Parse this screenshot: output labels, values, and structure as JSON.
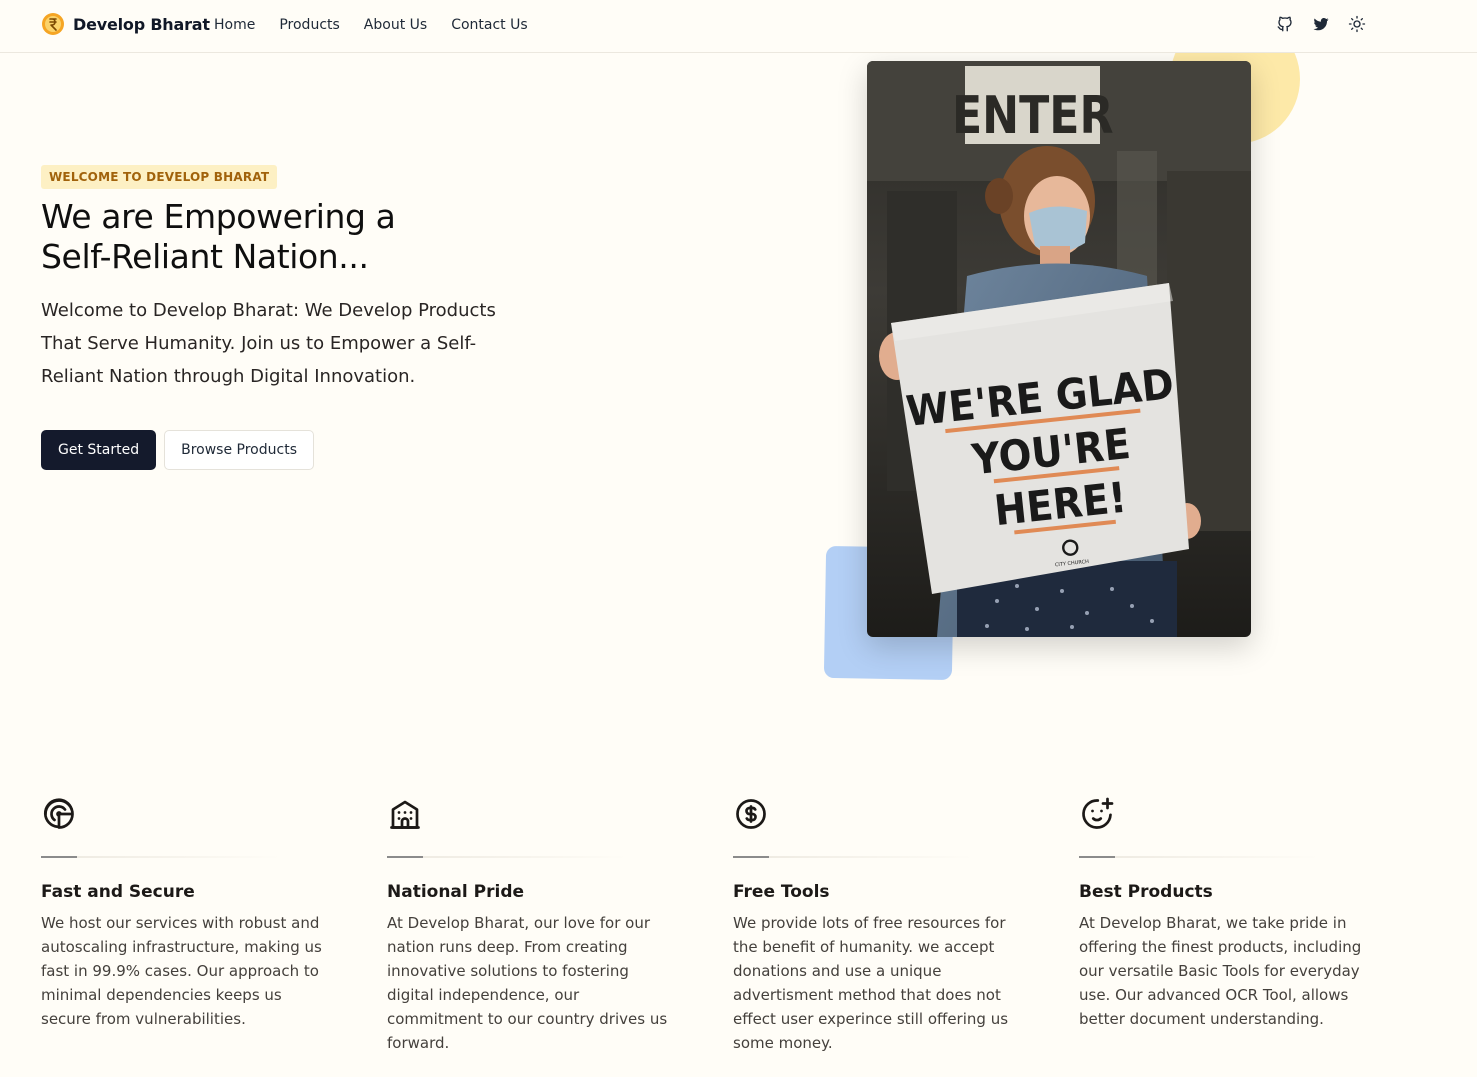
{
  "nav": {
    "brand": "Develop Bharat",
    "links": [
      "Home",
      "Products",
      "About Us",
      "Contact Us"
    ],
    "icons": [
      "github-icon",
      "twitter-icon",
      "sun-icon"
    ]
  },
  "hero": {
    "badge": "WELCOME TO DEVELOP BHARAT",
    "title_line1": "We are Empowering a",
    "title_line2": "Self-Reliant Nation...",
    "description": "Welcome to Develop Bharat: We Develop Products That Serve Humanity. Join us to Empower a Self-Reliant Nation through Digital Innovation.",
    "primary_button": "Get Started",
    "secondary_button": "Browse Products"
  },
  "photo": {
    "door_sign": "ENTER",
    "sign_line1": "WE'RE GLAD",
    "sign_line2": "YOU'RE",
    "sign_line3": "HERE!",
    "sign_logo_text": "CITY CHURCH"
  },
  "features": [
    {
      "icon": "radar-icon",
      "title": "Fast and Secure",
      "text": "We host our services with robust and autoscaling infrastructure, making us fast in 99.9% cases. Our approach to minimal dependencies keeps us secure from vulnerabilities."
    },
    {
      "icon": "building-icon",
      "title": "National Pride",
      "text": "At Develop Bharat, our love for our nation runs deep. From creating innovative solutions to fostering digital independence, our commitment to our country drives us forward."
    },
    {
      "icon": "dollar-icon",
      "title": "Free Tools",
      "text": "We provide lots of free resources for the benefit of humanity. we accept donations and use a unique advertisment method that does not effect user experince still offering us some money."
    },
    {
      "icon": "mood-plus-icon",
      "title": "Best Products",
      "text": "At Develop Bharat, we take pride in offering the finest products, including our versatile Basic Tools for everyday use. Our advanced OCR Tool, allows better document understanding."
    }
  ],
  "colors": {
    "background": "#fffdf7",
    "badge_bg": "#fdf0c4",
    "badge_text": "#a1620b",
    "primary_button": "#141a2c",
    "yellow_blob": "#fde9a8",
    "blue_blob": "#b3cff5"
  }
}
